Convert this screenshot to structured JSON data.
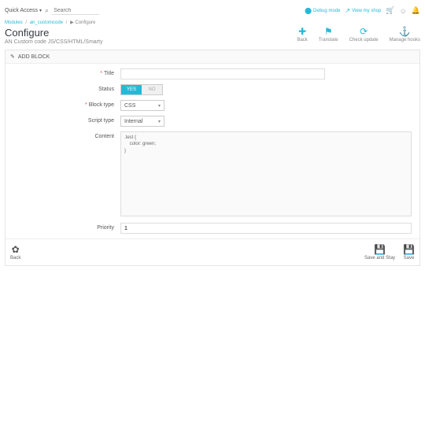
{
  "topbar": {
    "quick_access": "Quick Access",
    "search_placeholder": "Search",
    "debug_label": "Debug mode",
    "view_shop_label": "View my shop"
  },
  "breadcrumbs": {
    "a": "Modules",
    "b": "an_customcode",
    "c": "▶ Configure"
  },
  "page": {
    "title": "Configure",
    "subtitle": "AN Custom code JS/CSS/HTML/Smarty"
  },
  "header_actions": {
    "back": "Back",
    "translate": "Translate",
    "check_update": "Check update",
    "manage_hooks": "Manage hooks"
  },
  "panel": {
    "heading": "ADD BLOCK",
    "labels": {
      "title": "Title",
      "status": "Status",
      "block_type": "Block type",
      "script_type": "Script type",
      "content": "Content",
      "priority": "Priority"
    },
    "values": {
      "status_yes": "YES",
      "status_no": "NO",
      "block_type": "CSS",
      "script_type": "Internal",
      "content": ".test {\n    color: green;\n}",
      "priority": "1"
    },
    "footer": {
      "back": "Back",
      "save_stay": "Save and Stay",
      "save": "Save"
    }
  }
}
